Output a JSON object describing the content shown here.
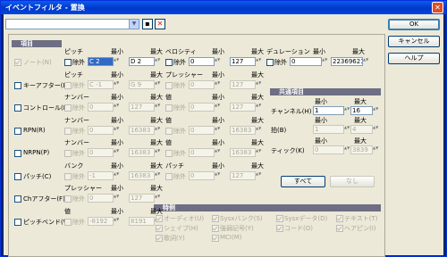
{
  "window_title": "イベントフィルタ - 置換",
  "buttons": {
    "ok": "OK",
    "cancel": "キャンセル",
    "help": "ヘルプ"
  },
  "section_item": "項目",
  "section_common": "共通項目",
  "section_special": "特例",
  "labels": {
    "min": "最小",
    "max": "最大",
    "exclude": "除外",
    "all": "すべて",
    "none": "なし"
  },
  "rows": [
    {
      "check": "ノート(N)",
      "checked": true,
      "cols": [
        {
          "name": "ピッチ",
          "v1": "C 2",
          "v2": "D 2"
        },
        {
          "name": "ベロシティ",
          "v1": "0",
          "v2": "127"
        },
        {
          "name": "デュレーション",
          "v1": "0",
          "v2": "223696212"
        }
      ]
    },
    {
      "check": "キーアフター(E)",
      "checked": false,
      "cols": [
        {
          "name": "ピッチ",
          "v1": "C -1",
          "v2": "G 9"
        },
        {
          "name": "プレッシャー",
          "v1": "0",
          "v2": "127"
        }
      ]
    },
    {
      "check": "コントロール(L)",
      "checked": false,
      "cols": [
        {
          "name": "ナンバー",
          "v1": "0",
          "v2": "127"
        },
        {
          "name": "値",
          "v1": "0",
          "v2": "127"
        }
      ]
    },
    {
      "check": "RPN(R)",
      "checked": false,
      "cols": [
        {
          "name": "ナンバー",
          "v1": "0",
          "v2": "16383"
        },
        {
          "name": "値",
          "v1": "0",
          "v2": "16383"
        }
      ]
    },
    {
      "check": "NRPN(P)",
      "checked": false,
      "cols": [
        {
          "name": "ナンバー",
          "v1": "0",
          "v2": "16383"
        },
        {
          "name": "値",
          "v1": "0",
          "v2": "16383"
        }
      ]
    },
    {
      "check": "パッチ(C)",
      "checked": false,
      "cols": [
        {
          "name": "バンク",
          "v1": "-1",
          "v2": "16383"
        },
        {
          "name": "パッチ",
          "v1": "0",
          "v2": "127"
        }
      ]
    },
    {
      "check": "Chアフター(F)",
      "checked": false,
      "cols": [
        {
          "name": "プレッシャー",
          "v1": "0",
          "v2": "127"
        }
      ]
    },
    {
      "check": "ピッチベンド(W)",
      "checked": false,
      "cols": [
        {
          "name": "値",
          "v1": "-8192",
          "v2": "8191"
        }
      ]
    }
  ],
  "common": [
    {
      "name": "チャンネル(H)",
      "v1": "1",
      "v2": "16",
      "enabled": true
    },
    {
      "name": "拍(B)",
      "v1": "1",
      "v2": "4",
      "enabled": false
    },
    {
      "name": "ティック(K)",
      "v1": "0",
      "v2": "3839",
      "enabled": false
    }
  ],
  "special": [
    {
      "label": "オーディオ(U)",
      "checked": true
    },
    {
      "label": "Sysxバンク(S)",
      "checked": true
    },
    {
      "label": "Sysxデータ(D)",
      "checked": true
    },
    {
      "label": "テキスト(T)",
      "checked": true
    },
    {
      "label": "シェイプ(H)",
      "checked": true
    },
    {
      "label": "強弱記号(Y)",
      "checked": true
    },
    {
      "label": "コード(O)",
      "checked": true
    },
    {
      "label": "ヘアピン(I)",
      "checked": true
    },
    {
      "label": "歌詞(Y)",
      "checked": true
    },
    {
      "label": "MCI(M)",
      "checked": true
    }
  ]
}
